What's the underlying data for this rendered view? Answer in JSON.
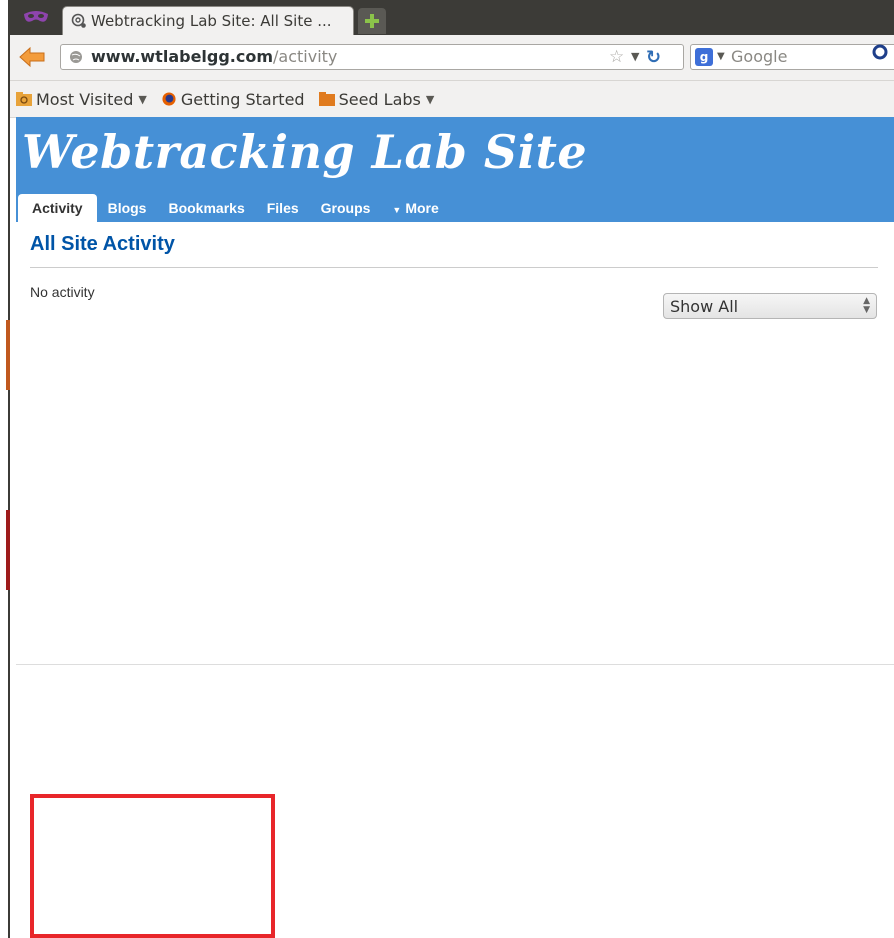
{
  "browser": {
    "tab_title": "Webtracking Lab Site: All Site ...",
    "url_domain": "www.wtlabelgg.com",
    "url_path": "/activity",
    "search_placeholder": "Google",
    "bookmarks": [
      {
        "label": "Most Visited",
        "icon": "bookmarks-folder-icon",
        "has_menu": true
      },
      {
        "label": "Getting Started",
        "icon": "firefox-icon",
        "has_menu": false
      },
      {
        "label": "Seed Labs",
        "icon": "folder-icon",
        "has_menu": true
      }
    ]
  },
  "site": {
    "title": "Webtracking Lab Site",
    "nav": [
      {
        "label": "Activity",
        "active": true
      },
      {
        "label": "Blogs"
      },
      {
        "label": "Bookmarks"
      },
      {
        "label": "Files"
      },
      {
        "label": "Groups"
      },
      {
        "label": "More",
        "has_menu": true
      }
    ],
    "header_color": "#4690d6"
  },
  "main": {
    "page_title": "All Site Activity",
    "empty_message": "No activity",
    "filter_value": "Show All"
  },
  "annotation": {
    "color": "#e8262a"
  }
}
